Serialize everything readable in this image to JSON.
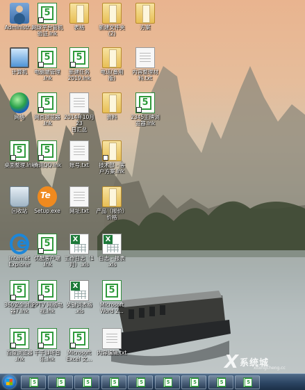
{
  "desktop": {
    "icons": [
      {
        "label": "Administr...",
        "type": "user"
      },
      {
        "label": "网球平台管机\n验证.lnk",
        "type": "green"
      },
      {
        "label": "表格",
        "type": "folder"
      },
      {
        "label": "新建文件夹\n(2)",
        "type": "folder"
      },
      {
        "label": "方案",
        "type": "folder"
      },
      {
        "label": "计算机",
        "type": "computer"
      },
      {
        "label": "电脑端管理\n.lnk",
        "type": "green"
      },
      {
        "label": "新建任务\n2019.lnk",
        "type": "green"
      },
      {
        "label": "电话(备用\n版)",
        "type": "folder"
      },
      {
        "label": "内容整理材\n料.txt",
        "type": "doc"
      },
      {
        "label": "网络",
        "type": "globe"
      },
      {
        "label": "网页浏览器\n.lnk",
        "type": "green"
      },
      {
        "label": "2014年10月23\n日汇总",
        "type": "doc"
      },
      {
        "label": "资料",
        "type": "folder"
      },
      {
        "label": "2345王牌浏\n览器.lnk",
        "type": "green"
      },
      {
        "label": "桌面整理.lnk",
        "type": "green"
      },
      {
        "label": "腾讯QQ.lnk",
        "type": "green"
      },
      {
        "label": "账号.txt",
        "type": "doc"
      },
      {
        "label": "技术部 - 客\n户方案.lnk",
        "type": "folder"
      },
      {
        "label": "回收站",
        "type": "recycle"
      },
      {
        "label": "Setup.exe",
        "type": "setup"
      },
      {
        "label": "网址.txt",
        "type": "doc"
      },
      {
        "label": "产品（报价）\n价格",
        "type": "folder"
      },
      {
        "label": "Internet\nExplorer",
        "type": "ie"
      },
      {
        "label": "优酷客户端\n.lnk",
        "type": "green"
      },
      {
        "label": "工作日志（1\n月）.xls",
        "type": "excel"
      },
      {
        "label": "日志 - 报表\n.xls",
        "type": "excel"
      },
      {
        "label": "360安全浏览\n器7.lnk",
        "type": "green"
      },
      {
        "label": "PPTV 网络电\n视.lnk",
        "type": "green"
      },
      {
        "label": "关键词表格\n.xls",
        "type": "excel"
      },
      {
        "label": "Microsoft\nWord 2...",
        "type": "word"
      },
      {
        "label": "百度浏览器\n.lnk",
        "type": "green"
      },
      {
        "label": "千千静听音\n乐.lnk",
        "type": "green"
      },
      {
        "label": "Microsoft\nExcel 文...",
        "type": "green"
      },
      {
        "label": "内容编辑.txt",
        "type": "doc"
      }
    ]
  },
  "taskbar": {
    "start_label": "开始",
    "buttons": [
      {
        "icon": "spreadsheet-app-icon"
      },
      {
        "icon": "spreadsheet-app-icon"
      },
      {
        "icon": "spreadsheet-app-icon"
      },
      {
        "icon": "spreadsheet-app-icon"
      },
      {
        "icon": "spreadsheet-app-icon"
      },
      {
        "icon": "spreadsheet-app-icon"
      },
      {
        "icon": "spreadsheet-app-icon"
      },
      {
        "icon": "spreadsheet-app-icon"
      },
      {
        "icon": "spreadsheet-app-icon"
      }
    ]
  },
  "watermark": {
    "text": "系统城",
    "sub": "xitongcheng.cc"
  }
}
